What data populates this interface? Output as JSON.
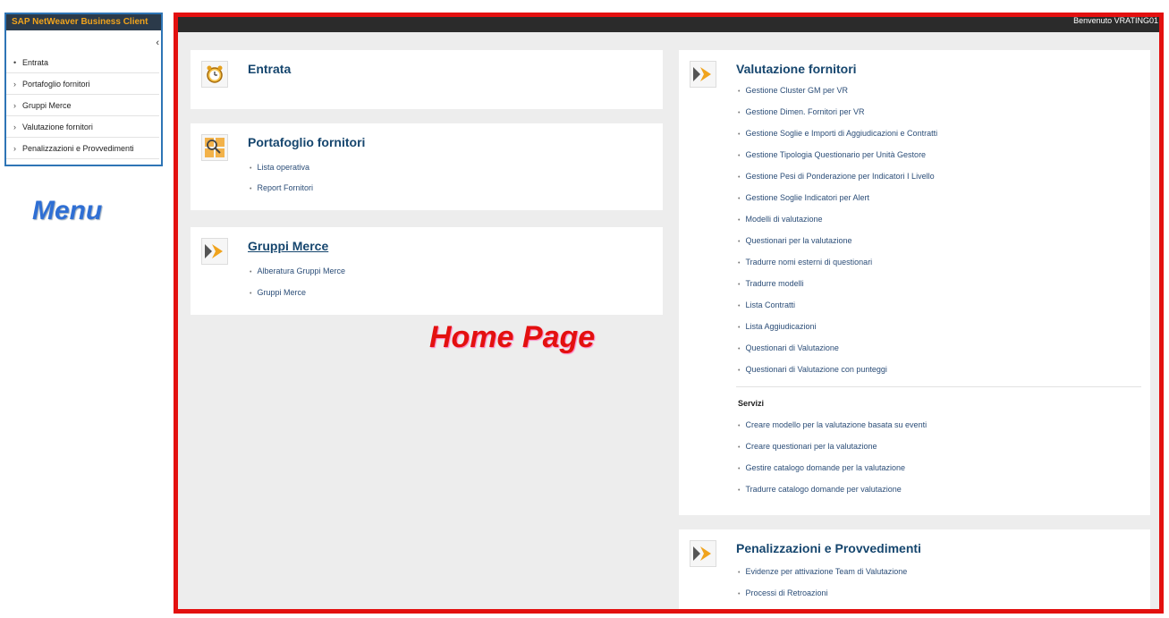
{
  "app": {
    "title": "SAP NetWeaver Business Client",
    "collapse_glyph": "‹"
  },
  "header": {
    "welcome": "Benvenuto VRATING01"
  },
  "sidebar": {
    "items": [
      {
        "mark": "•",
        "label": "Entrata"
      },
      {
        "mark": "›",
        "label": "Portafoglio fornitori"
      },
      {
        "mark": "›",
        "label": "Gruppi Merce"
      },
      {
        "mark": "›",
        "label": "Valutazione fornitori"
      },
      {
        "mark": "›",
        "label": "Penalizzazioni e Provvedimenti"
      }
    ]
  },
  "annotations": {
    "menu": "Menu",
    "home": "Home Page"
  },
  "cards": {
    "entrata": {
      "title": "Entrata",
      "icon": "alarm-clock-icon"
    },
    "portafoglio": {
      "title": "Portafoglio fornitori",
      "icon": "magnifier-grid-icon",
      "links": [
        "Lista operativa",
        "Report Fornitori"
      ]
    },
    "gruppi": {
      "title": "Gruppi Merce",
      "icon": "arrow-icon",
      "links": [
        "Alberatura Gruppi Merce",
        "Gruppi Merce"
      ]
    },
    "valutazione": {
      "title": "Valutazione fornitori",
      "icon": "arrow-icon",
      "links": [
        "Gestione Cluster GM per VR",
        "Gestione Dimen. Fornitori per VR",
        "Gestione Soglie e Importi di Aggiudicazioni e Contratti",
        "Gestione Tipologia Questionario per Unità Gestore",
        "Gestione Pesi di Ponderazione per Indicatori I Livello",
        "Gestione Soglie Indicatori per Alert",
        "Modelli di valutazione",
        "Questionari per la valutazione",
        "Tradurre nomi esterni di questionari",
        "Tradurre modelli",
        "Lista Contratti",
        "Lista Aggiudicazioni",
        "Questionari di Valutazione",
        "Questionari di Valutazione con punteggi"
      ],
      "services_title": "Servizi",
      "services": [
        "Creare modello per la valutazione basata su eventi",
        "Creare questionari per la valutazione",
        "Gestire catalogo domande per la valutazione",
        "Tradurre catalogo domande per valutazione"
      ]
    },
    "penalizzazioni": {
      "title": "Penalizzazioni e Provvedimenti",
      "icon": "arrow-icon",
      "links": [
        "Evidenze per attivazione Team di Valutazione",
        "Processi di Retroazioni"
      ]
    }
  },
  "colors": {
    "accent_red": "#e3100f",
    "menu_blue": "#2f6fd4",
    "title_blue": "#16466e",
    "arrow_orange": "#f0a31c"
  }
}
